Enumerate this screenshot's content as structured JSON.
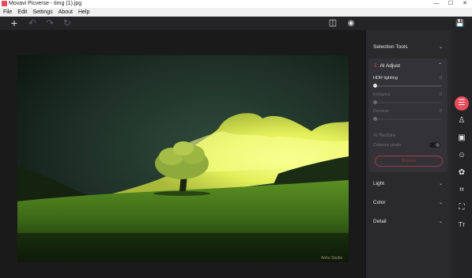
{
  "window": {
    "title": "Movavi Picverse - timg (1).jpg",
    "minimize": "—",
    "maximize": "☐",
    "close": "✕"
  },
  "menu": [
    "File",
    "Edit",
    "Settings",
    "About",
    "Help"
  ],
  "toolbar": {
    "add": "+",
    "undo": "↶",
    "redo": "↷",
    "reset": "↻",
    "compare": "◫",
    "preview": "◉",
    "save": "💾"
  },
  "panel": {
    "selection_tools": "Selection Tools",
    "ai_adjust": {
      "title": "AI Adjust",
      "sliders": [
        {
          "label": "HDR lighting",
          "value": "0",
          "enabled": true
        },
        {
          "label": "Enhance",
          "value": "0",
          "enabled": false
        },
        {
          "label": "Denoise",
          "value": "0",
          "enabled": false
        }
      ],
      "ai_restore": "AI Restore",
      "colorize": "Colorize photo",
      "restore_button": "Restore"
    },
    "sections": [
      "Light",
      "Color",
      "Detail"
    ]
  },
  "photo": {
    "watermark": "Anhu Studio"
  },
  "rail": [
    {
      "name": "adjust-icon",
      "glyph": "☰",
      "active": true
    },
    {
      "name": "stamp-icon",
      "glyph": "♙",
      "active": false
    },
    {
      "name": "background-icon",
      "glyph": "▣",
      "active": false
    },
    {
      "name": "face-retouch-icon",
      "glyph": "☺",
      "active": false
    },
    {
      "name": "filters-icon",
      "glyph": "✿",
      "active": false
    },
    {
      "name": "crop-icon",
      "glyph": "⌗",
      "active": false
    },
    {
      "name": "resize-icon",
      "glyph": "⛶",
      "active": false
    },
    {
      "name": "text-icon",
      "glyph": "Tт",
      "active": false
    }
  ],
  "colors": {
    "accent": "#e84c5a",
    "panel": "#2a2a2d",
    "canvas": "#1a1a1a"
  }
}
